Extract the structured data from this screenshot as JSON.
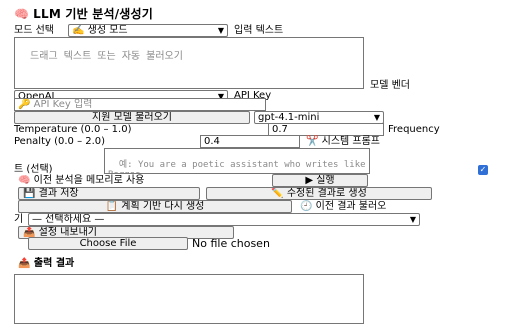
{
  "app": {
    "title": "LLM 기반 분석/생성기",
    "title_icon": "🧠"
  },
  "mode": {
    "label": "모드 선택",
    "selected": "✍️ 생성 모드"
  },
  "input": {
    "label": "입력 텍스트",
    "placeholder": "드래그 텍스트 또는 자동 불러오기"
  },
  "vendor": {
    "label": "모델 벤더",
    "selected": "OpenAI"
  },
  "api_key": {
    "label": "API Key",
    "placeholder": "🔑 API Key 입력"
  },
  "model": {
    "load_button": "지원 모델 불러오기",
    "selected": "gpt-4.1-mini"
  },
  "temperature": {
    "label": "Temperature (0.0 – 1.0)",
    "value": "0.7"
  },
  "frequency": {
    "label": "Frequency",
    "label2": "Penalty (0.0 – 2.0)",
    "value": "0.4"
  },
  "system_prompt": {
    "label": "✂️ 시스템 프롬프",
    "label_tail": "트 (선택)",
    "placeholder": "예: You are a poetic assistant who writes like Borges..."
  },
  "memory": {
    "label": "🧠 이전 분석을 메모리로 사용",
    "checked": true
  },
  "run_button": "▶ 실행",
  "save_result_button": "💾 결과 저장",
  "save_revised_button": "✏️ 수정된 결과로 생성",
  "regenerate_button": "📋 계획 기반 다시 생성",
  "load_previous": {
    "label": "🕘 이전 결과 불러오",
    "label_tail": "기",
    "selected": "— 선택하세요 —"
  },
  "export_button": "📤 설정 내보내기",
  "file": {
    "button": "Choose File",
    "status": "No file chosen"
  },
  "output": {
    "label": "📤 출력 결과"
  }
}
